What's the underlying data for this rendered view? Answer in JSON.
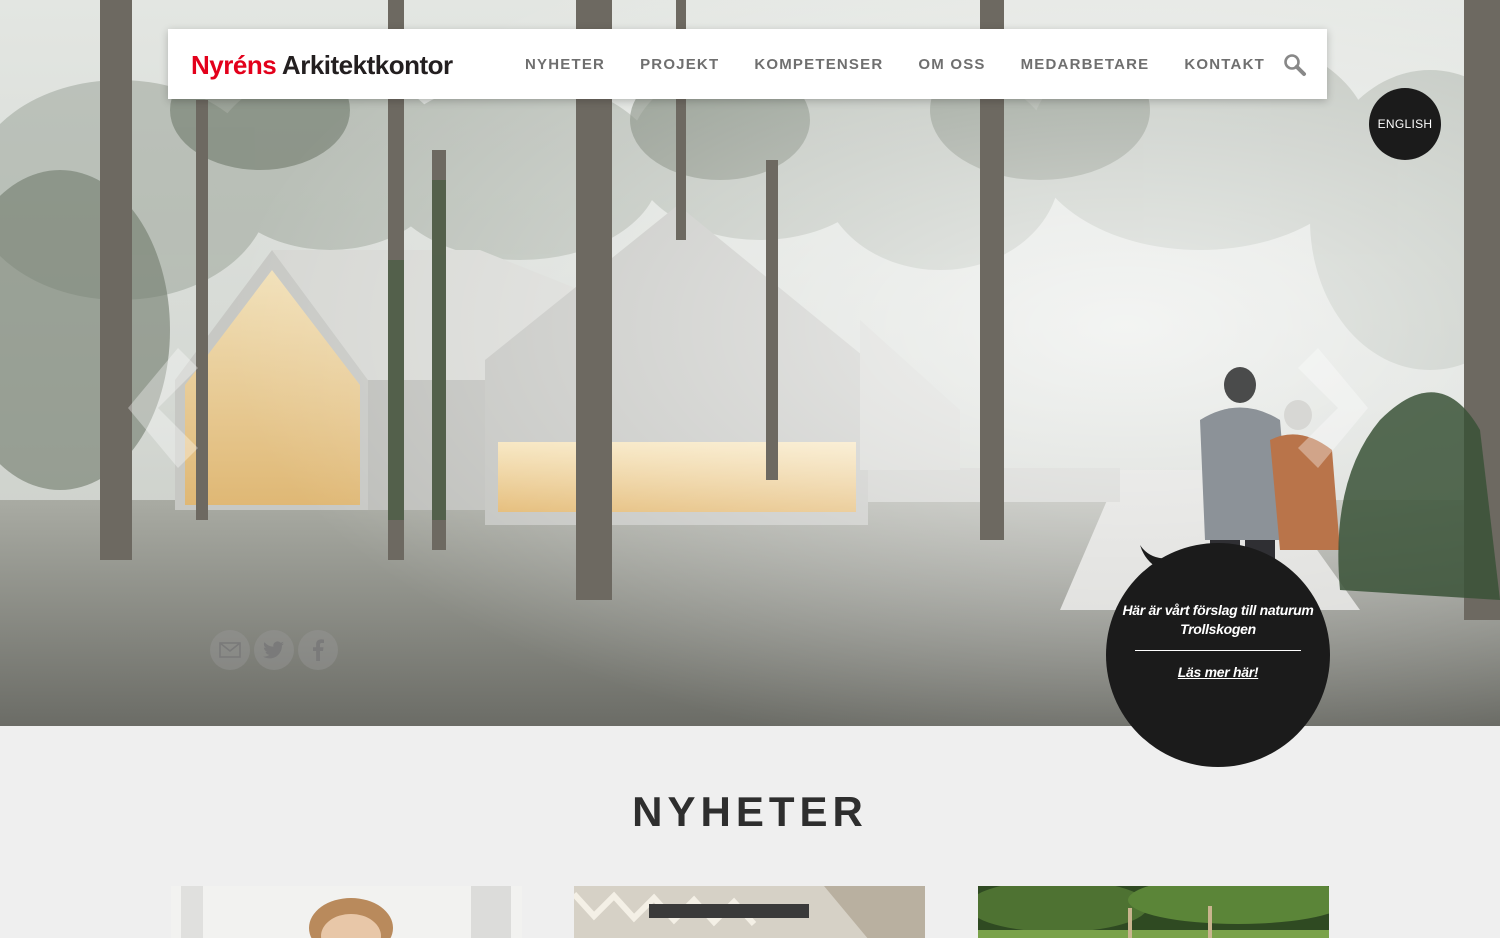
{
  "logo": {
    "part1": "Nyréns",
    "part2": "Arkitektkontor"
  },
  "nav": {
    "items": [
      {
        "label": "NYHETER"
      },
      {
        "label": "PROJEKT"
      },
      {
        "label": "KOMPETENSER"
      },
      {
        "label": "OM OSS"
      },
      {
        "label": "MEDARBETARE"
      },
      {
        "label": "KONTAKT"
      }
    ],
    "search_icon": "search-icon"
  },
  "language_button": "ENGLISH",
  "hero": {
    "bubble_text": "Här är vårt förslag till naturum Trollskogen",
    "bubble_link": "Läs mer här!",
    "arrow_left_icon": "chevron-left-icon",
    "arrow_right_icon": "chevron-right-icon"
  },
  "social": {
    "icons": [
      "mail-icon",
      "twitter-icon",
      "facebook-icon"
    ]
  },
  "news": {
    "title": "NYHETER"
  },
  "colors": {
    "brand_red": "#e3001b",
    "dark": "#1b1b1b",
    "page_bg": "#efefef"
  }
}
